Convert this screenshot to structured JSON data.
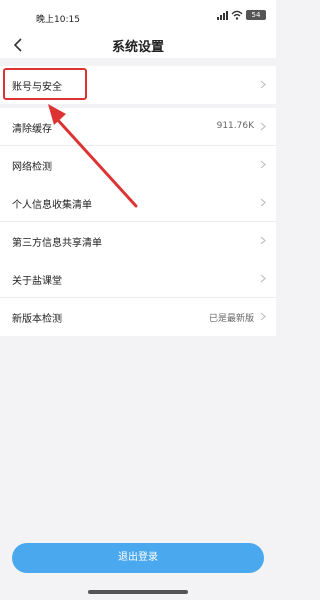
{
  "status_bar": {
    "time": "晚上10:15",
    "battery": "54",
    "icons": [
      "signal-icon",
      "wifi-icon",
      "battery-icon"
    ]
  },
  "header": {
    "title": "系统设置",
    "back_icon": "chevron-left-icon"
  },
  "groups": [
    {
      "rows": [
        {
          "label": "账号与安全",
          "value": ""
        }
      ]
    },
    {
      "rows": [
        {
          "label": "清除缓存",
          "value": "911.76K"
        },
        {
          "label": "网络检测",
          "value": ""
        }
      ]
    },
    {
      "rows": [
        {
          "label": "个人信息收集清单",
          "value": ""
        },
        {
          "label": "第三方信息共享清单",
          "value": ""
        }
      ]
    },
    {
      "rows": [
        {
          "label": "关于盐课堂",
          "value": ""
        },
        {
          "label": "新版本检测",
          "value": "已是最新版"
        }
      ]
    }
  ],
  "logout_label": "退出登录",
  "colors": {
    "accent": "#4aa8ee",
    "annotation": "#dd3333",
    "background": "#f3f3f5"
  }
}
